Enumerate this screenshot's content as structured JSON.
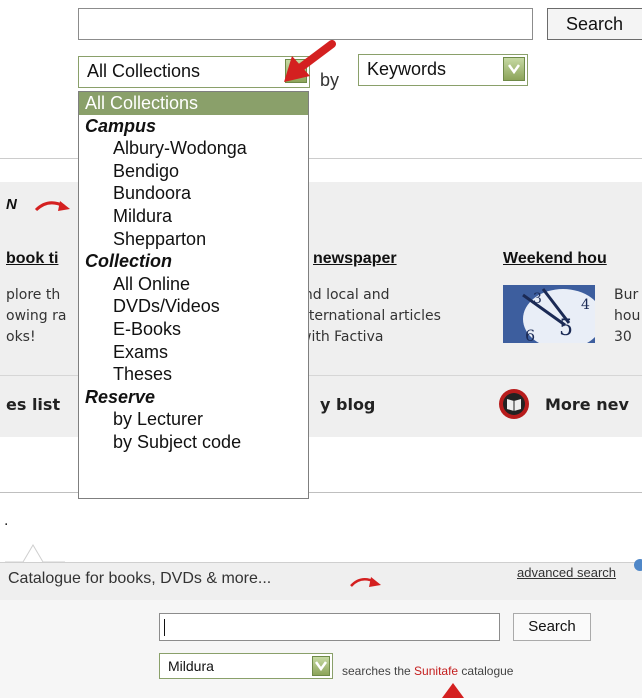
{
  "search": {
    "button_label": "Search"
  },
  "collection_select": {
    "value": "All Collections",
    "by_label": "by",
    "field_value": "Keywords"
  },
  "dropdown": {
    "selected": "All Collections",
    "groups": [
      {
        "label": "Campus",
        "items": [
          "Albury-Wodonga",
          "Bendigo",
          "Bundoora",
          "Mildura",
          "Shepparton"
        ]
      },
      {
        "label": "Collection",
        "items": [
          "All Online",
          "DVDs/Videos",
          "E-Books",
          "Exams",
          "Theses"
        ]
      },
      {
        "label": "Reserve",
        "items": [
          "by Lecturer",
          "by Subject code"
        ]
      }
    ]
  },
  "background": {
    "heading_fragment": "N",
    "col1": {
      "title": "book ti",
      "text": "plore th\nowing ra\noks!"
    },
    "col2": {
      "title": "newspaper",
      "text": "ind local and\nnternational articles\nwith Factiva"
    },
    "col3": {
      "title": "Weekend hou",
      "text": "Bur\nhou\n30"
    },
    "bottom_left": "es list",
    "blog": "y blog",
    "more_news": "More nev"
  },
  "separator_dot": ".",
  "catalogue": {
    "title": "Catalogue for books, DVDs & more...",
    "advanced_link": "advanced search",
    "search_button": "Search",
    "campus_value": "Mildura",
    "searches_prefix": "searches the ",
    "catalogue_name": "Sunitafe",
    "searches_suffix": " catalogue"
  },
  "colors": {
    "accent_green": "#8aa06a",
    "arrow_red": "#d42020",
    "brand_red": "#c41e1e"
  },
  "icons": [
    "dropdown-arrow-icon",
    "red-arrow-icon",
    "curved-arrow-icon",
    "clock-image",
    "book-icon",
    "info-icon",
    "up-arrow-icon"
  ]
}
